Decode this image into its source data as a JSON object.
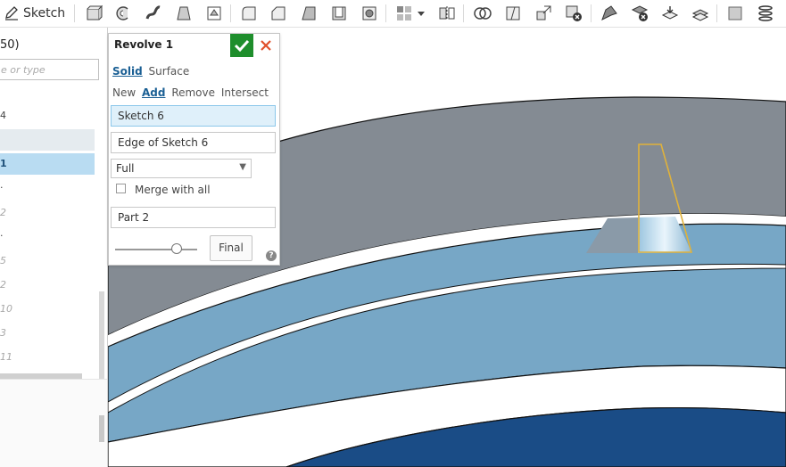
{
  "toolbar": {
    "sketch_label": "Sketch",
    "icons": [
      "extrude-icon",
      "revolve-icon",
      "sweep-icon",
      "loft-icon",
      "thicken-icon",
      "fillet-icon",
      "chamfer-icon",
      "draft-icon",
      "shell-icon",
      "hole-icon",
      "pattern-icon",
      "dropdown-icon",
      "mirror-icon",
      "boolean-icon",
      "split-icon",
      "transform-icon",
      "delete-part-icon",
      "modify-fillet-icon",
      "delete-face-icon",
      "move-face-icon",
      "replace-face-icon",
      "plane-icon",
      "helix-icon"
    ]
  },
  "left_panel": {
    "title_fragment": "50)",
    "search_placeholder": "e or type",
    "rows": [
      {
        "text": "4",
        "style": "normal"
      },
      {
        "text": "",
        "style": "grey"
      },
      {
        "text": "1",
        "style": "selected"
      },
      {
        "text": ".",
        "style": "normal"
      },
      {
        "text": "2",
        "style": "faded"
      },
      {
        "text": ".",
        "style": "normal"
      },
      {
        "text": "5",
        "style": "faded"
      },
      {
        "text": "2",
        "style": "faded"
      },
      {
        "text": "10",
        "style": "faded"
      },
      {
        "text": "3",
        "style": "faded"
      },
      {
        "text": "11",
        "style": "faded"
      }
    ]
  },
  "dialog": {
    "title": "Revolve 1",
    "body_types": {
      "solid": "Solid",
      "surface": "Surface"
    },
    "operations": {
      "new": "New",
      "add": "Add",
      "remove": "Remove",
      "intersect": "Intersect"
    },
    "faces_field": "Sketch 6",
    "axis_field": "Edge of Sketch 6",
    "revolve_type": "Full",
    "merge_label": "Merge with all",
    "merge_checked": false,
    "merge_scope_field": "Part 2",
    "final_button": "Final",
    "help_glyph": "?",
    "slider_fraction": 0.75
  },
  "colors": {
    "confirm": "#1e8e2c",
    "cancel": "#e0502a",
    "selection": "#b9dcf2",
    "part_grey": "#838a92",
    "part_light_blue": "#78a9c8",
    "part_dark_blue": "#1a4c86",
    "sketch_highlight": "#e0b23b"
  }
}
